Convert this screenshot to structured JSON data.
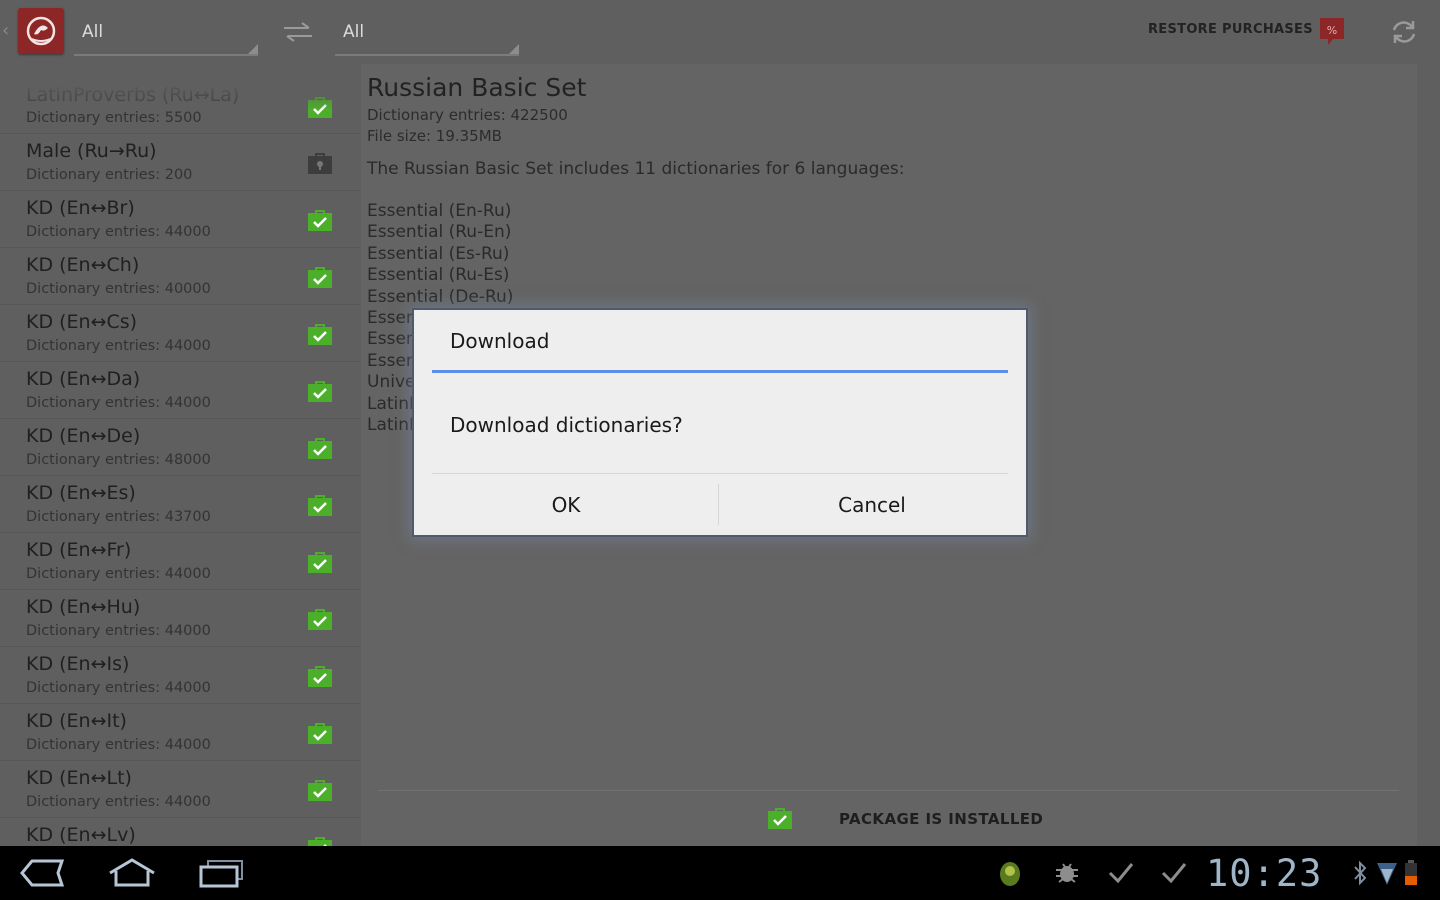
{
  "action_bar": {
    "from_language": "All",
    "to_language": "All",
    "restore_purchases_label": "RESTORE PURCHASES",
    "icons": [
      "app-logo-icon",
      "swap-icon",
      "sale-tag-icon",
      "refresh-icon"
    ]
  },
  "dictionary_list": {
    "items": [
      {
        "title": "LatinProverbs (Ru↔La)",
        "entries": "Dictionary entries: 5500",
        "status": "installed"
      },
      {
        "title": "Male (Ru→Ru)",
        "entries": "Dictionary entries: 200",
        "status": "locked"
      },
      {
        "title": "KD (En↔Br)",
        "entries": "Dictionary entries: 44000",
        "status": "installed"
      },
      {
        "title": "KD (En↔Ch)",
        "entries": "Dictionary entries: 40000",
        "status": "installed"
      },
      {
        "title": "KD (En↔Cs)",
        "entries": "Dictionary entries: 44000",
        "status": "installed"
      },
      {
        "title": "KD (En↔Da)",
        "entries": "Dictionary entries: 44000",
        "status": "installed"
      },
      {
        "title": "KD (En↔De)",
        "entries": "Dictionary entries: 48000",
        "status": "installed"
      },
      {
        "title": "KD (En↔Es)",
        "entries": "Dictionary entries: 43700",
        "status": "installed"
      },
      {
        "title": "KD (En↔Fr)",
        "entries": "Dictionary entries: 44000",
        "status": "installed"
      },
      {
        "title": "KD (En↔Hu)",
        "entries": "Dictionary entries: 44000",
        "status": "installed"
      },
      {
        "title": "KD (En↔Is)",
        "entries": "Dictionary entries: 44000",
        "status": "installed"
      },
      {
        "title": "KD (En↔It)",
        "entries": "Dictionary entries: 44000",
        "status": "installed"
      },
      {
        "title": "KD (En↔Lt)",
        "entries": "Dictionary entries: 44000",
        "status": "installed"
      },
      {
        "title": "KD (En↔Lv)",
        "entries": "",
        "status": "installed"
      }
    ]
  },
  "detail": {
    "title": "Russian Basic Set",
    "entries": "Dictionary entries: 422500",
    "file_size": "File size: 19.35MB",
    "description": "The Russian Basic Set includes 11 dictionaries for 6 languages:",
    "dictionaries": [
      "Essential (En-Ru)",
      "Essential (Ru-En)",
      "Essential (Es-Ru)",
      "Essential (Ru-Es)",
      "Essential (De-Ru)",
      "Essen",
      "Essen",
      "Essen",
      "Unive",
      "LatinF",
      "LatinF"
    ],
    "status_label": "PACKAGE IS INSTALLED"
  },
  "dialog": {
    "title": "Download",
    "message": "Download dictionaries?",
    "ok_label": "OK",
    "cancel_label": "Cancel"
  },
  "system_bar": {
    "clock": "10:23",
    "icons": [
      "back-icon",
      "home-icon",
      "recent-apps-icon",
      "android-notification-icon",
      "usb-debug-icon",
      "check-icon",
      "check-icon",
      "bluetooth-icon",
      "wifi-icon",
      "battery-icon"
    ]
  },
  "colors": {
    "accent": "#5c8fe6",
    "installed_green": "#4caf2a",
    "brand_red": "#8d2626"
  }
}
